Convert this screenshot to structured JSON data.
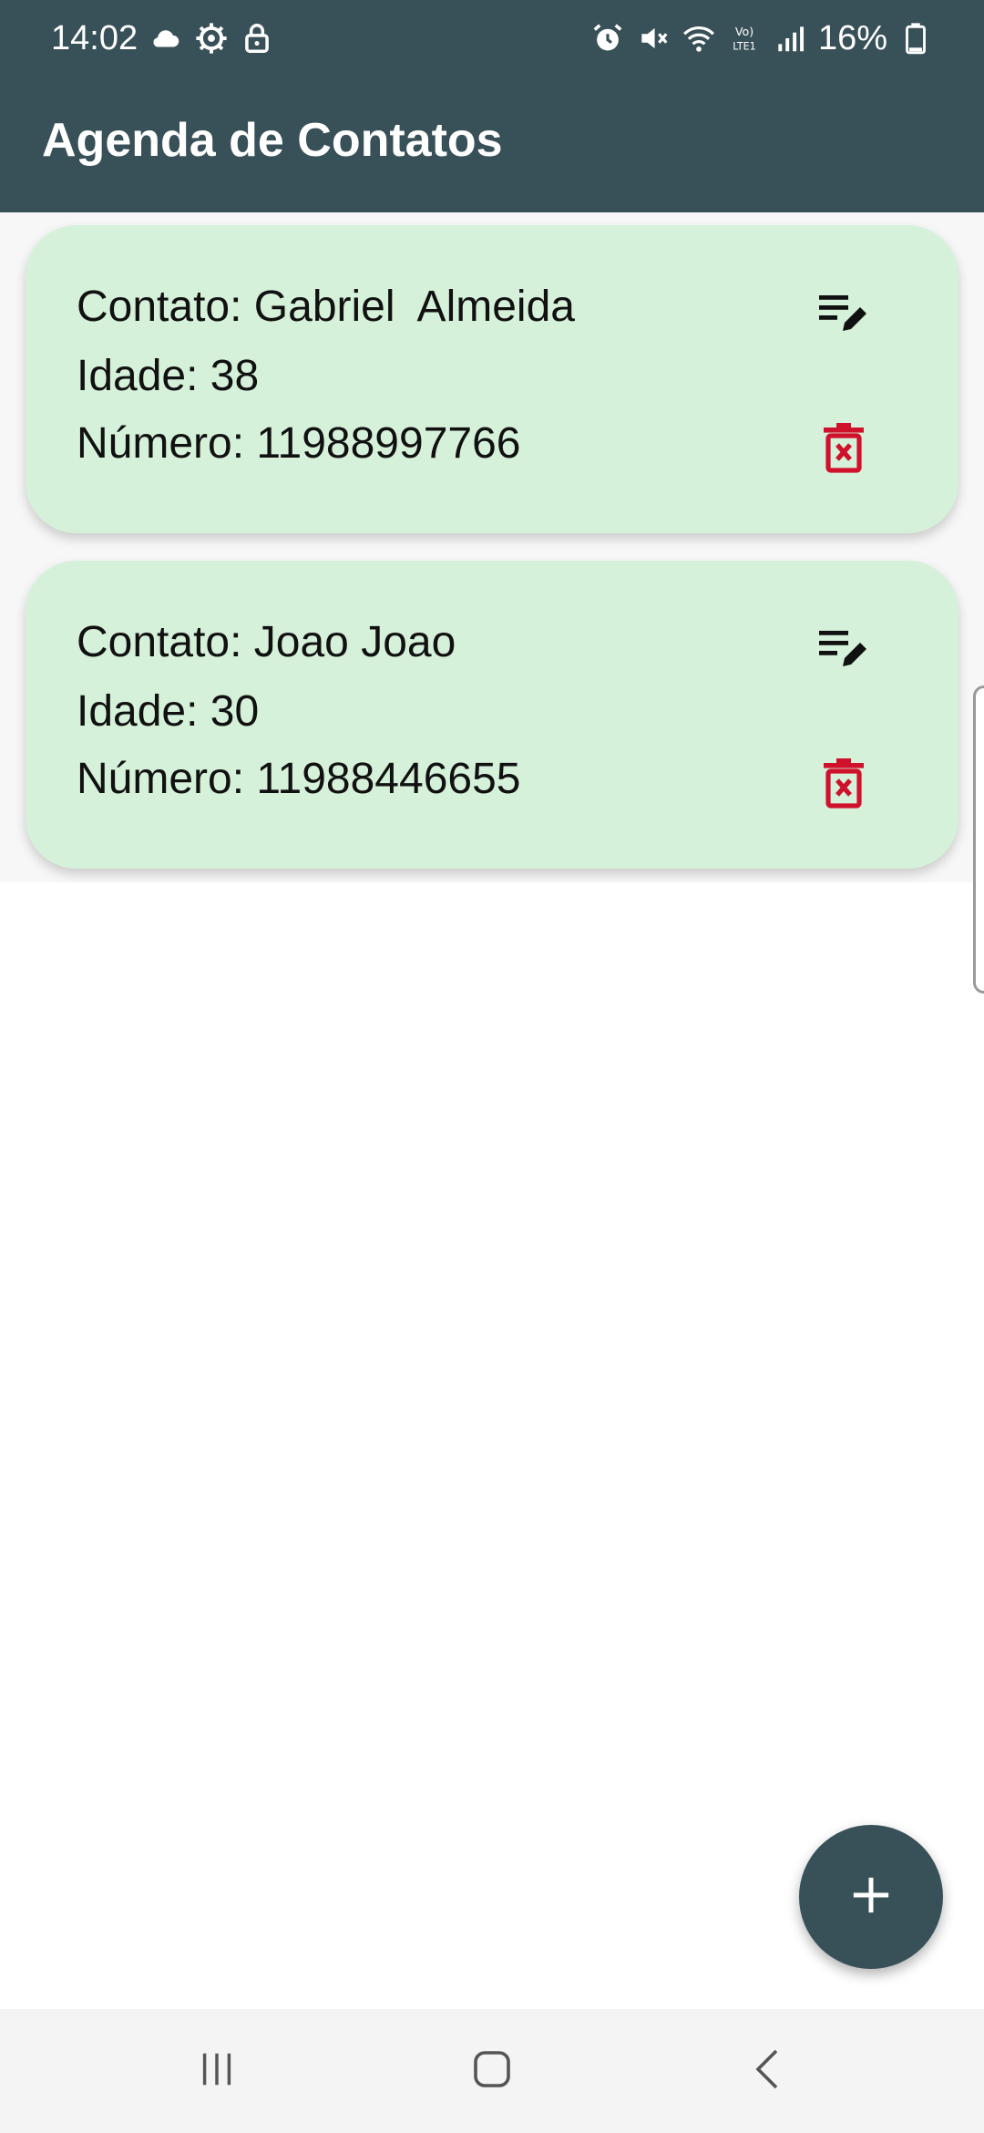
{
  "status_bar": {
    "time": "14:02",
    "left_icons": [
      "cloud-icon",
      "gear-icon",
      "lock-icon"
    ],
    "right_icons": [
      "alarm-icon",
      "mute-icon",
      "wifi-icon",
      "volte-icon",
      "signal-icon",
      "battery-icon"
    ],
    "battery_percent": "16%"
  },
  "app_bar": {
    "title": "Agenda de Contatos",
    "color": "#385057"
  },
  "contacts": [
    {
      "contato_line": "Contato: Gabriel  Almeida",
      "idade_line": "Idade: 38",
      "numero_line": "Número: 11988997766",
      "edit_icon": "edit-note-icon",
      "delete_icon": "delete-icon"
    },
    {
      "contato_line": "Contato: Joao Joao",
      "idade_line": "Idade: 30",
      "numero_line": "Número: 11988446655",
      "edit_icon": "edit-note-icon",
      "delete_icon": "delete-icon"
    }
  ],
  "colors": {
    "card_bg": "#d6f1da",
    "delete": "#d0112b",
    "fab": "#385057"
  },
  "fab": {
    "icon": "plus-icon"
  },
  "nav_bar": {
    "icons": [
      "recents-icon",
      "home-icon",
      "back-icon"
    ]
  }
}
